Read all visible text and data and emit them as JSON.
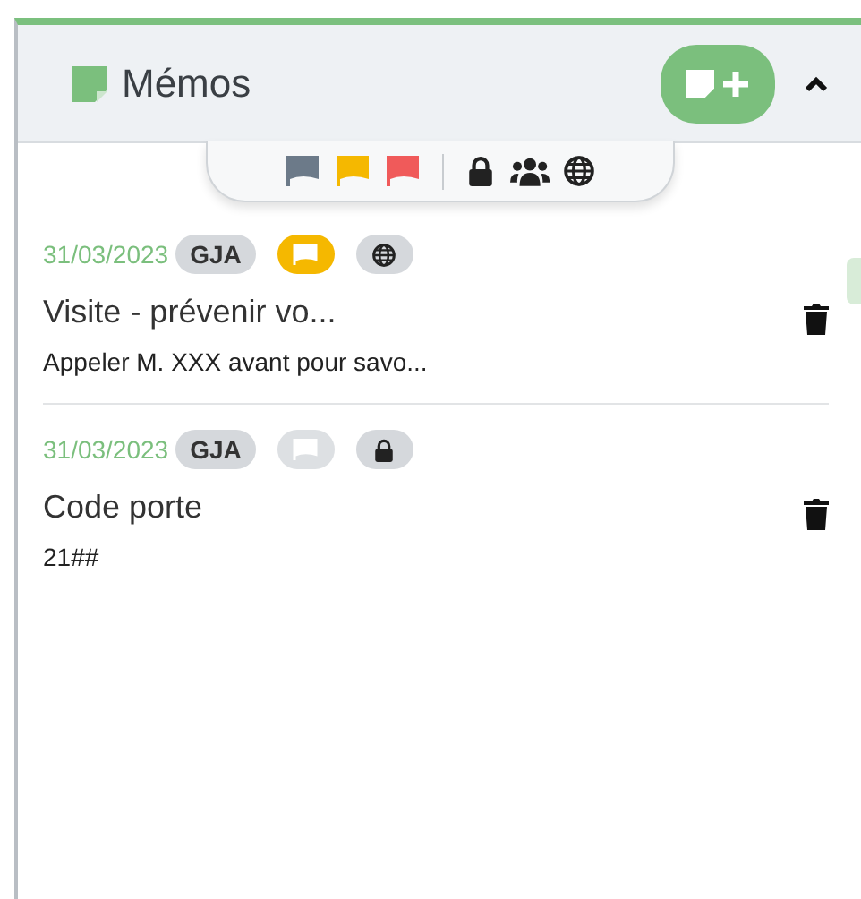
{
  "panel": {
    "title": "Mémos"
  },
  "filters": {
    "flags": [
      {
        "color": "#6c7a89"
      },
      {
        "color": "#f5b800"
      },
      {
        "color": "#f05a5a"
      }
    ],
    "visibility": [
      {
        "kind": "private"
      },
      {
        "kind": "group"
      },
      {
        "kind": "public"
      }
    ]
  },
  "memos": [
    {
      "date": "31/03/2023",
      "author": "GJA",
      "flagged": true,
      "visibility": {
        "kind": "public"
      },
      "title": "Visite - prévenir vo...",
      "body": "Appeler M. XXX avant pour savo..."
    },
    {
      "date": "31/03/2023",
      "author": "GJA",
      "flagged": false,
      "visibility": {
        "kind": "private"
      },
      "title": "Code porte",
      "body": "21##"
    }
  ]
}
